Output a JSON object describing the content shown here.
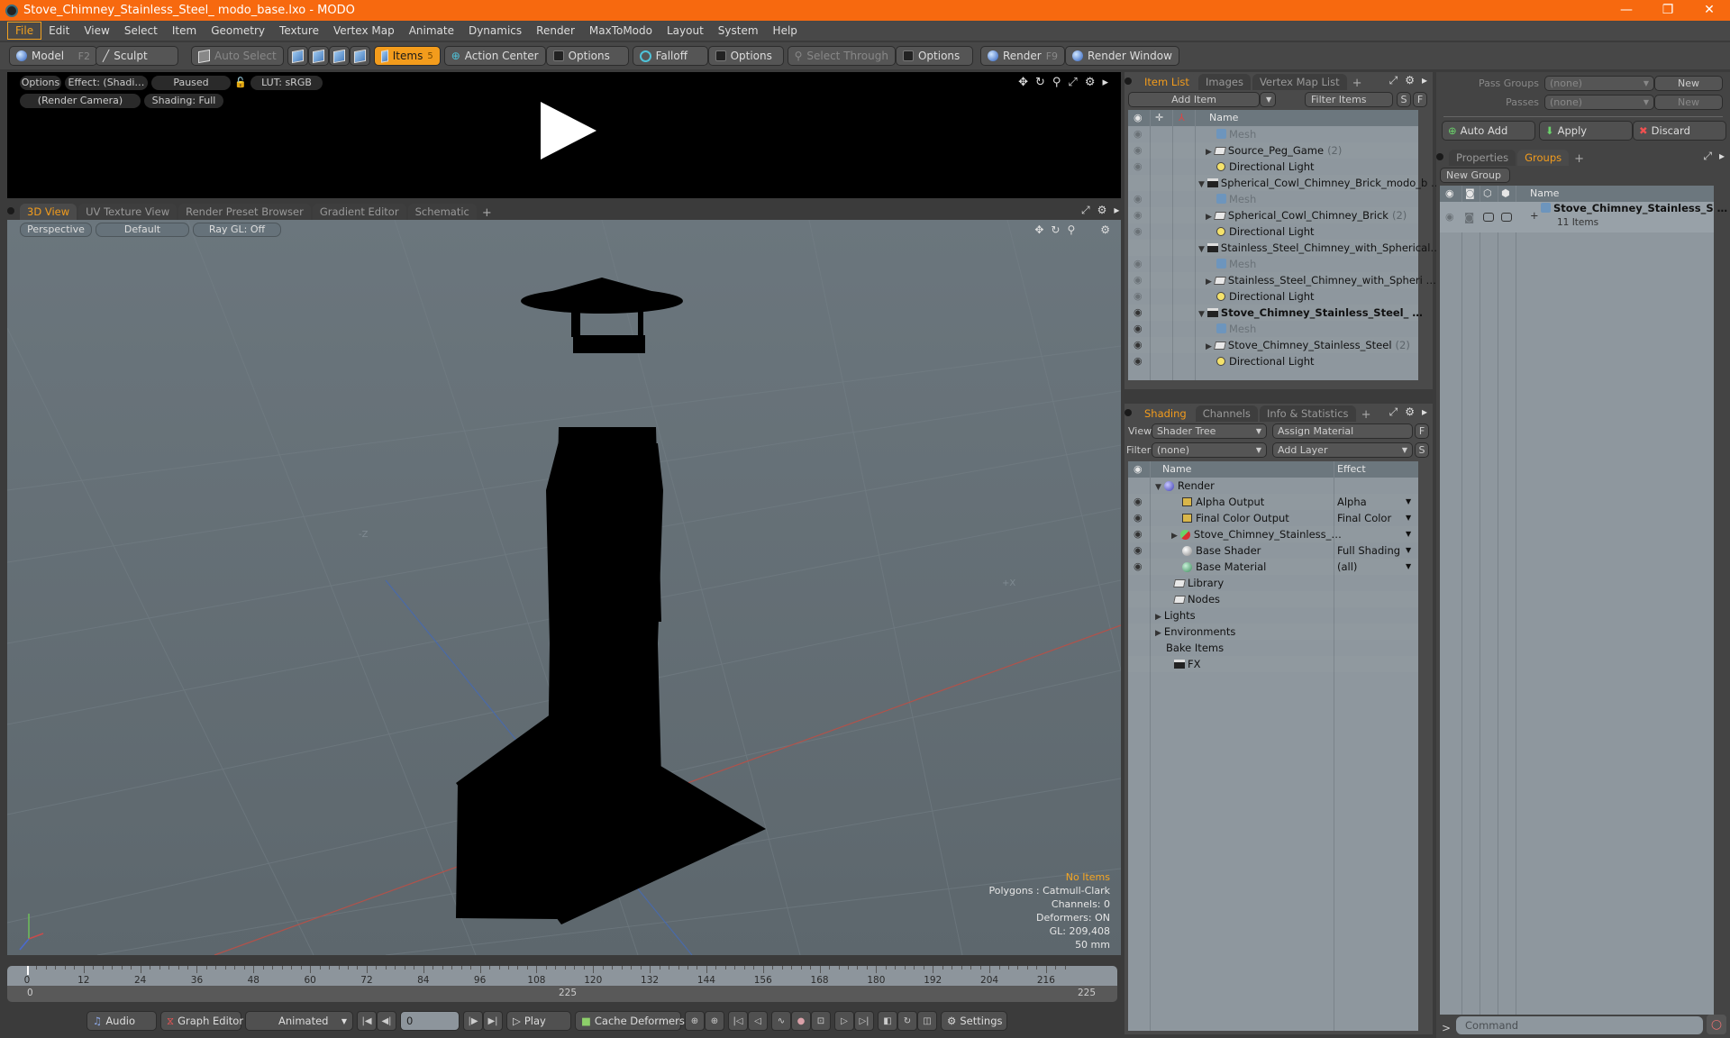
{
  "window": {
    "title": "Stove_Chimney_Stainless_Steel_ modo_base.lxo - MODO",
    "controls": {
      "minimize": "—",
      "maximize": "❐",
      "close": "✕"
    }
  },
  "menu": [
    "File",
    "Edit",
    "View",
    "Select",
    "Item",
    "Geometry",
    "Texture",
    "Vertex Map",
    "Animate",
    "Dynamics",
    "Render",
    "MaxToModo",
    "Layout",
    "System",
    "Help"
  ],
  "toolbar": {
    "model": "Model",
    "model_key": "F2",
    "sculpt": "Sculpt",
    "auto_select": "Auto Select",
    "items": "Items",
    "items_key": "5",
    "action_center": "Action Center",
    "options1": "Options",
    "falloff": "Falloff",
    "options2": "Options",
    "select_through": "Select Through",
    "options3": "Options",
    "render": "Render",
    "render_key": "F9",
    "render_window": "Render Window"
  },
  "preview": {
    "options": "Options",
    "effect": "Effect: (Shadi…",
    "paused": "Paused",
    "lut": "LUT: sRGB",
    "camera": "(Render Camera)",
    "shading": "Shading: Full"
  },
  "viewport_tabs": [
    "3D View",
    "UV Texture View",
    "Render Preset Browser",
    "Gradient Editor",
    "Schematic"
  ],
  "viewport": {
    "perspective": "Perspective",
    "default": "Default",
    "raygl": "Ray GL: Off",
    "axis_neg_z": "-Z",
    "axis_pos_x": "+X",
    "stats": {
      "selection": "No Items",
      "polygons": "Polygons : Catmull-Clark",
      "channels": "Channels: 0",
      "deformers": "Deformers: ON",
      "gl": "GL: 209,408",
      "focal": "50 mm"
    }
  },
  "timeline": {
    "ticks": [
      "0",
      "12",
      "24",
      "36",
      "48",
      "60",
      "72",
      "84",
      "96",
      "108",
      "120",
      "132",
      "144",
      "156",
      "168",
      "180",
      "192",
      "204",
      "216"
    ],
    "range_start": "0",
    "range_end_mid": "225",
    "range_end": "225",
    "current_frame": "0"
  },
  "transport": {
    "audio": "Audio",
    "graph_editor": "Graph Editor",
    "animated": "Animated",
    "frame_value": "0",
    "play": "Play",
    "cache_deformers": "Cache Deformers",
    "settings": "Settings"
  },
  "item_list": {
    "tabs": [
      "Item List",
      "Images",
      "Vertex Map List"
    ],
    "add_item": "Add Item",
    "filter_items": "Filter Items",
    "s_btn": "S",
    "f_btn": "F",
    "column_name": "Name",
    "rows": [
      {
        "name": "Mesh",
        "type": "mesh",
        "indent": 2,
        "dim": true,
        "eye": "faint"
      },
      {
        "name": "Source_Peg_Game",
        "count": "(2)",
        "type": "folder",
        "indent": 2,
        "expander": "▶",
        "eye": "faint"
      },
      {
        "name": "Directional Light",
        "type": "light",
        "indent": 2,
        "eye": "faint"
      },
      {
        "name": "Spherical_Cowl_Chimney_Brick_modo_b …",
        "type": "scene",
        "indent": 1,
        "expander": "▼",
        "eye": "none"
      },
      {
        "name": "Mesh",
        "type": "mesh",
        "indent": 2,
        "dim": true,
        "eye": "faint"
      },
      {
        "name": "Spherical_Cowl_Chimney_Brick",
        "count": "(2)",
        "type": "folder",
        "indent": 2,
        "expander": "▶",
        "eye": "faint"
      },
      {
        "name": "Directional Light",
        "type": "light",
        "indent": 2,
        "eye": "faint"
      },
      {
        "name": "Stainless_Steel_Chimney_with_Spherical…",
        "type": "scene",
        "indent": 1,
        "expander": "▼",
        "eye": "none"
      },
      {
        "name": "Mesh",
        "type": "mesh",
        "indent": 2,
        "dim": true,
        "eye": "faint"
      },
      {
        "name": "Stainless_Steel_Chimney_with_Spheri …",
        "type": "folder",
        "indent": 2,
        "expander": "▶",
        "eye": "faint"
      },
      {
        "name": "Directional Light",
        "type": "light",
        "indent": 2,
        "eye": "faint"
      },
      {
        "name": "Stove_Chimney_Stainless_Steel_ …",
        "type": "scene",
        "indent": 1,
        "expander": "▼",
        "bold": true,
        "eye": "on"
      },
      {
        "name": "Mesh",
        "type": "mesh",
        "indent": 2,
        "dim": true,
        "eye": "on"
      },
      {
        "name": "Stove_Chimney_Stainless_Steel",
        "count": "(2)",
        "type": "folder",
        "indent": 2,
        "expander": "▶",
        "eye": "on"
      },
      {
        "name": "Directional Light",
        "type": "light",
        "indent": 2,
        "eye": "on"
      }
    ]
  },
  "shading": {
    "tabs": [
      "Shading",
      "Channels",
      "Info & Statistics"
    ],
    "view_label": "View",
    "view_value": "Shader Tree",
    "assign_material": "Assign Material",
    "f_btn": "F",
    "filter_label": "Filter",
    "filter_value": "(none)",
    "add_layer": "Add Layer",
    "s_btn": "S",
    "col_name": "Name",
    "col_effect": "Effect",
    "rows": [
      {
        "name": "Render",
        "effect": "",
        "icon": "render-sphere",
        "indent": 0,
        "expander": "▼",
        "eye": false,
        "dropdown": false
      },
      {
        "name": "Alpha Output",
        "effect": "Alpha",
        "icon": "output",
        "indent": 1,
        "eye": true,
        "dropdown": true
      },
      {
        "name": "Final Color Output",
        "effect": "Final Color",
        "icon": "output",
        "indent": 1,
        "eye": true,
        "dropdown": true
      },
      {
        "name": "Stove_Chimney_Stainless_…",
        "effect": "",
        "icon": "material-group",
        "indent": 1,
        "expander": "▶",
        "eye": true,
        "dropdown": true
      },
      {
        "name": "Base Shader",
        "effect": "Full Shading",
        "icon": "shader",
        "indent": 1,
        "eye": true,
        "dropdown": true
      },
      {
        "name": "Base Material",
        "effect": "(all)",
        "icon": "material",
        "indent": 1,
        "eye": true,
        "dropdown": true
      },
      {
        "name": "Library",
        "effect": "",
        "icon": "folder",
        "indent": 0.5,
        "eye": false,
        "dropdown": false
      },
      {
        "name": "Nodes",
        "effect": "",
        "icon": "folder",
        "indent": 0.5,
        "eye": false,
        "dropdown": false
      },
      {
        "name": "Lights",
        "effect": "",
        "icon": "none",
        "indent": 0,
        "expander": "▶",
        "eye": false,
        "dropdown": false
      },
      {
        "name": "Environments",
        "effect": "",
        "icon": "none",
        "indent": 0,
        "expander": "▶",
        "eye": false,
        "dropdown": false
      },
      {
        "name": "Bake Items",
        "effect": "",
        "icon": "none",
        "indent": 0,
        "eye": false,
        "dropdown": false
      },
      {
        "name": "FX",
        "effect": "",
        "icon": "clap",
        "indent": 0.5,
        "eye": false,
        "dropdown": false
      }
    ]
  },
  "passes": {
    "pass_groups_label": "Pass Groups",
    "pass_groups_value": "(none)",
    "new1": "New",
    "passes_label": "Passes",
    "passes_value": "(none)",
    "new2": "New",
    "auto_add": "Auto Add",
    "apply": "Apply",
    "discard": "Discard"
  },
  "groups": {
    "tabs": [
      "Properties",
      "Groups"
    ],
    "new_group": "New Group",
    "col_name": "Name",
    "group_name": "Stove_Chimney_Stainless_S …",
    "group_count": "11 Items"
  },
  "command": {
    "prompt": ">",
    "placeholder": "Command"
  },
  "colors": {
    "accent": "#f39c1c",
    "titlebar": "#f7690f",
    "list_bg": "#8e979e",
    "viewport_bg": "#66727a"
  }
}
